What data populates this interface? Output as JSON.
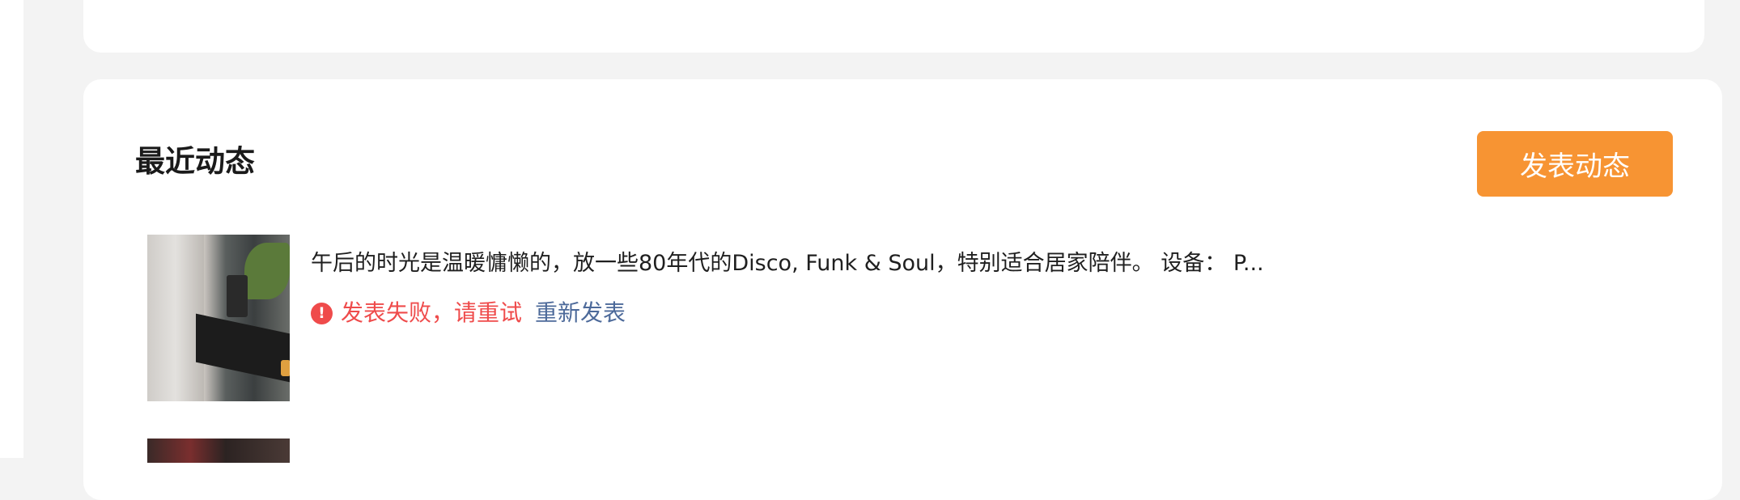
{
  "section": {
    "title": "最近动态",
    "post_button_label": "发表动态"
  },
  "feed": [
    {
      "text": "午后的时光是温暖慵懒的，放一些80年代的Disco, Funk & Soul，特别适合居家陪伴。 设备： P...",
      "status_icon": "!",
      "error_message": "发表失败，请重试",
      "retry_label": "重新发表"
    }
  ],
  "colors": {
    "accent": "#f79433",
    "error": "#ef4b4b",
    "link": "#4d6a9a",
    "page_bg": "#f3f3f3",
    "card_bg": "#ffffff"
  }
}
